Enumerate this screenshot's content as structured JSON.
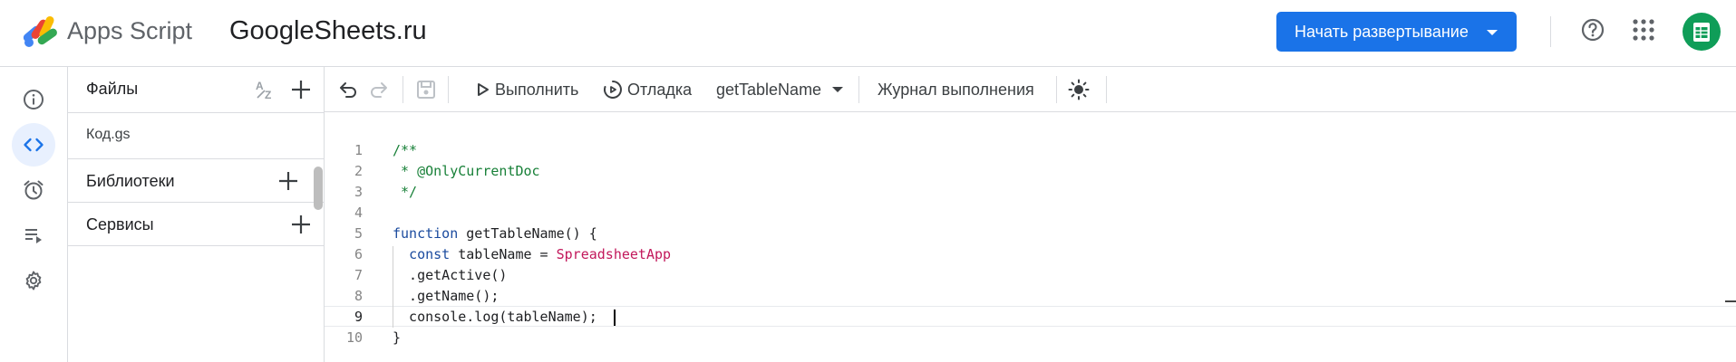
{
  "header": {
    "product_name": "Apps Script",
    "project_name": "GoogleSheets.ru",
    "deploy_label": "Начать развертывание",
    "icons": [
      "apps-script-logo",
      "chevron-down-icon",
      "help-icon",
      "apps-grid-icon",
      "sheets-avatar-icon"
    ],
    "colors": {
      "deploy_bg": "#1a73e8",
      "avatar": "#0f9d58"
    }
  },
  "rail": {
    "items": [
      "info-icon",
      "code-icon",
      "triggers-alarm-icon",
      "executions-icon",
      "settings-gear-icon"
    ],
    "active": "code-icon"
  },
  "files_panel": {
    "title": "Файлы",
    "files": [
      "Код.gs"
    ],
    "sections": [
      "Библиотеки",
      "Сервисы"
    ]
  },
  "toolbar": {
    "run_label": "Выполнить",
    "debug_label": "Отладка",
    "function_name": "getTableName",
    "log_label": "Журнал выполнения"
  },
  "editor": {
    "current_line": 9,
    "lines": [
      {
        "n": "1",
        "text": "/**"
      },
      {
        "n": "2",
        "text": " * @OnlyCurrentDoc"
      },
      {
        "n": "3",
        "text": " */"
      },
      {
        "n": "4",
        "text": ""
      },
      {
        "n": "5",
        "text": "function getTableName() {"
      },
      {
        "n": "6",
        "text": "  const tableName = SpreadsheetApp"
      },
      {
        "n": "7",
        "text": "  .getActive()"
      },
      {
        "n": "8",
        "text": "  .getName();"
      },
      {
        "n": "9",
        "text": "  console.log(tableName);"
      },
      {
        "n": "10",
        "text": "}"
      }
    ]
  }
}
